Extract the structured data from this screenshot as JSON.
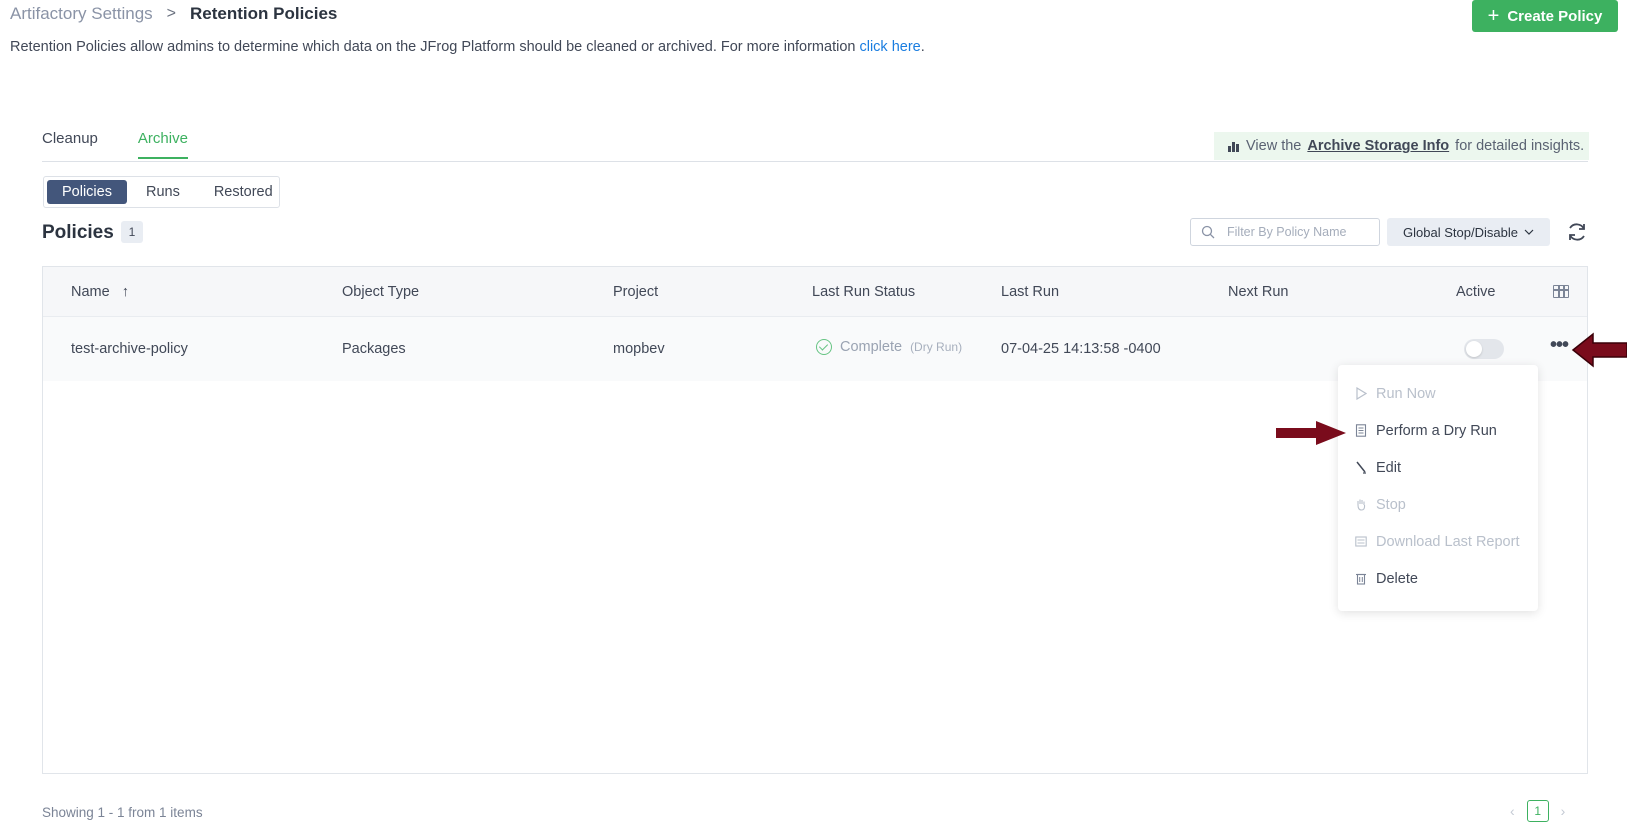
{
  "breadcrumb": {
    "parent": "Artifactory Settings",
    "separator": ">",
    "current": "Retention Policies"
  },
  "header": {
    "create_button": "Create Policy"
  },
  "description": {
    "text": "Retention Policies allow admins to determine which data on the JFrog Platform should be cleaned or archived. For more information ",
    "link": "click here",
    "end": "."
  },
  "tabs": [
    {
      "label": "Cleanup",
      "active": false
    },
    {
      "label": "Archive",
      "active": true
    }
  ],
  "archive_info": {
    "prefix": "View the ",
    "link": "Archive Storage Info",
    "suffix": " for detailed insights."
  },
  "subtabs": [
    {
      "label": "Policies",
      "active": true
    },
    {
      "label": "Runs",
      "active": false
    },
    {
      "label": "Restored",
      "active": false
    }
  ],
  "policies": {
    "title": "Policies",
    "count": "1"
  },
  "filter": {
    "placeholder": "Filter By Policy Name"
  },
  "global_button": "Global Stop/Disable",
  "table": {
    "headers": [
      "Name",
      "Object Type",
      "Project",
      "Last Run Status",
      "Last Run",
      "Next Run",
      "Active"
    ],
    "sort": {
      "column": "Name",
      "direction": "ascending"
    },
    "rows": [
      {
        "name": "test-archive-policy",
        "object_type": "Packages",
        "project": "mopbev",
        "status": "Complete",
        "status_note": "(Dry Run)",
        "last_run": "07-04-25 14:13:58 -0400",
        "next_run": "",
        "active": false
      }
    ]
  },
  "menu": {
    "items": [
      {
        "label": "Run Now",
        "icon": "play-icon",
        "disabled": true
      },
      {
        "label": "Perform a Dry Run",
        "icon": "document-icon",
        "disabled": false
      },
      {
        "label": "Edit",
        "icon": "pencil-icon",
        "disabled": false
      },
      {
        "label": "Stop",
        "icon": "hand-icon",
        "disabled": true
      },
      {
        "label": "Download Last Report",
        "icon": "report-icon",
        "disabled": true
      },
      {
        "label": "Delete",
        "icon": "trash-icon",
        "disabled": false
      }
    ]
  },
  "footer": {
    "showing": "Showing 1 - 1 from 1 items",
    "page": "1",
    "prev": "‹",
    "next": "›"
  },
  "colors": {
    "accent": "#3db160",
    "link": "#1a7de0",
    "subtab_active": "#43567b",
    "annotation_arrow": "#7a0c1c"
  }
}
